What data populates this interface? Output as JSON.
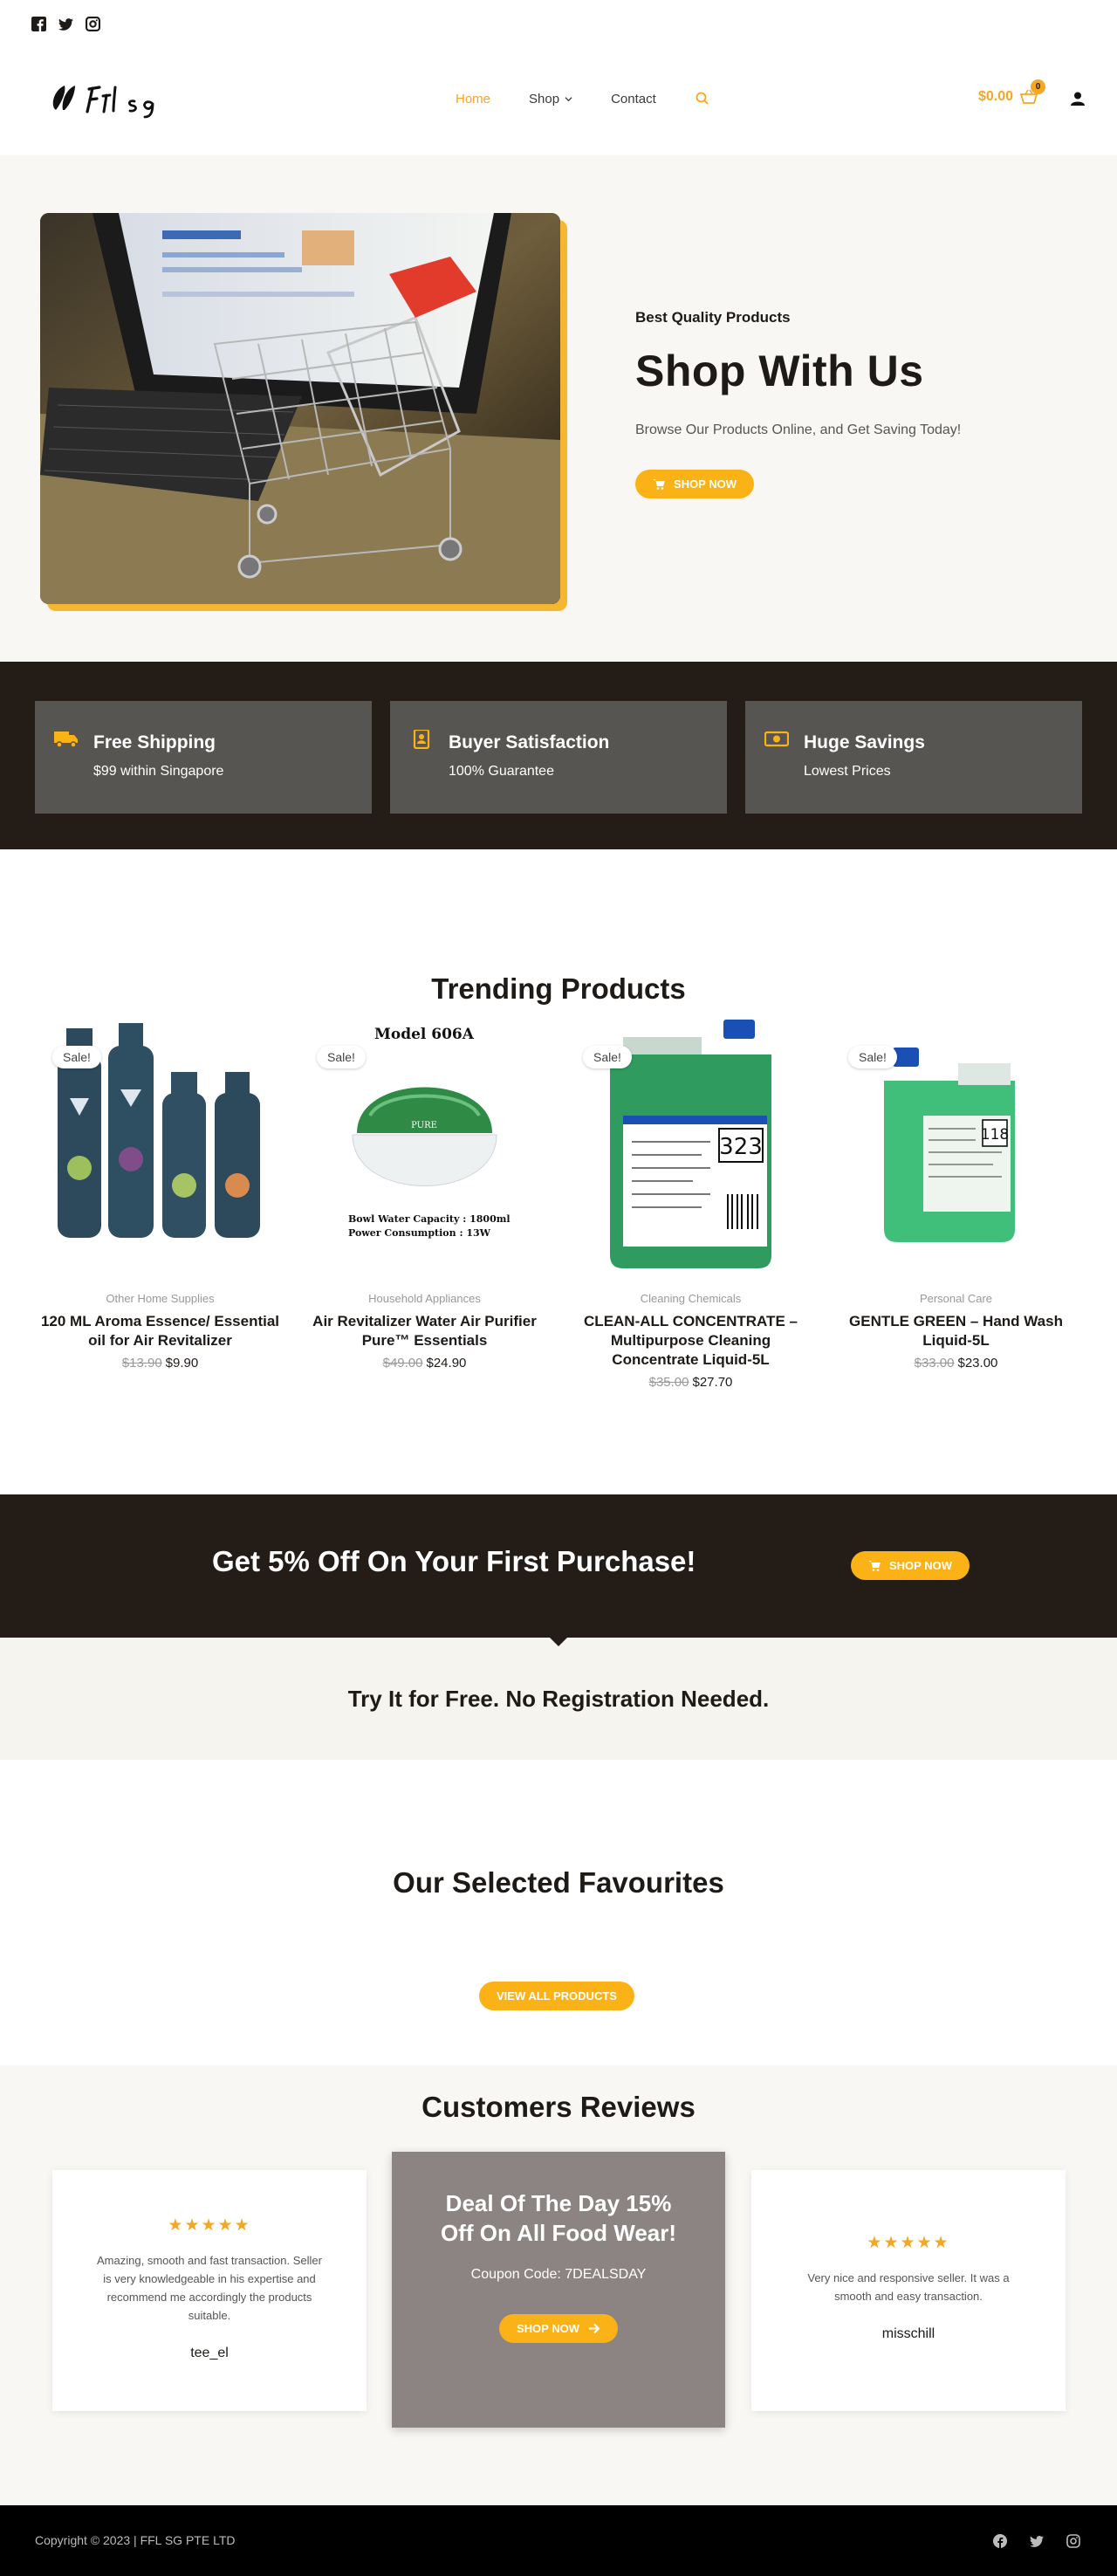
{
  "colors": {
    "accent": "#fbb216",
    "dark": "#231c17",
    "card": "#575552",
    "deal": "#8c8483"
  },
  "topbar": {
    "icons": [
      "facebook-icon",
      "twitter-icon",
      "instagram-icon"
    ]
  },
  "header": {
    "nav": [
      {
        "label": "Home",
        "active": true
      },
      {
        "label": "Shop",
        "active": false
      },
      {
        "label": "Contact",
        "active": false
      }
    ],
    "cart_amount": "$0.00",
    "cart_count": "0"
  },
  "hero": {
    "eyebrow": "Best Quality Products",
    "title": "Shop With Us",
    "subtitle": "Browse Our Products Online, and Get Saving Today!",
    "button": "SHOP NOW"
  },
  "features": [
    {
      "title": "Free Shipping",
      "subtitle": "$99 within Singapore",
      "icon": "truck-icon"
    },
    {
      "title": "Buyer Satisfaction",
      "subtitle": "100% Guarantee",
      "icon": "badge-icon"
    },
    {
      "title": "Huge Savings",
      "subtitle": "Lowest Prices",
      "icon": "money-icon"
    }
  ],
  "trending": {
    "title": "Trending Products",
    "sale_label": "Sale!",
    "products": [
      {
        "category": "Other Home Supplies",
        "name": "120 ML Aroma Essence/ Essential oil for Air Revitalizer",
        "old_price": "$13.90",
        "price": "$9.90"
      },
      {
        "category": "Household Appliances",
        "name": "Air Revitalizer Water Air Purifier Pure™ Essentials",
        "old_price": "$49.00",
        "price": "$24.90",
        "img_title": "Model 606A",
        "img_brand": "PURE",
        "img_spec1": "Bowl Water Capacity : 1800ml",
        "img_spec2": "Power Consumption  : 13W"
      },
      {
        "category": "Cleaning Chemicals",
        "name": "CLEAN-ALL CONCENTRATE – Multipurpose Cleaning Concentrate Liquid-5L",
        "old_price": "$35.00",
        "price": "$27.70",
        "img_code": "323"
      },
      {
        "category": "Personal Care",
        "name": "GENTLE GREEN – Hand Wash Liquid-5L",
        "old_price": "$33.00",
        "price": "$23.00",
        "img_code": "118"
      }
    ]
  },
  "promo": {
    "text": "Get 5% Off On Your First Purchase!",
    "button": "SHOP NOW",
    "try_free": "Try It for Free. No Registration Needed."
  },
  "favourites": {
    "title": "Our Selected Favourites",
    "button": "VIEW ALL PRODUCTS"
  },
  "reviews": {
    "title": "Customers Reviews",
    "stars": "★★★★★",
    "items": [
      {
        "text": "Amazing, smooth and fast transaction. Seller is very knowledgeable in his expertise and recommend me accordingly the products suitable.",
        "name": "tee_el"
      },
      {
        "text": "Very nice and responsive seller. It was a smooth and easy transaction.",
        "name": "misschill"
      }
    ],
    "deal": {
      "title": "Deal Of The Day 15% Off On All Food Wear!",
      "code": "Coupon Code: 7DEALSDAY",
      "button": "SHOP NOW"
    }
  },
  "footer": {
    "copyright": "Copyright © 2023 | FFL SG PTE LTD"
  }
}
